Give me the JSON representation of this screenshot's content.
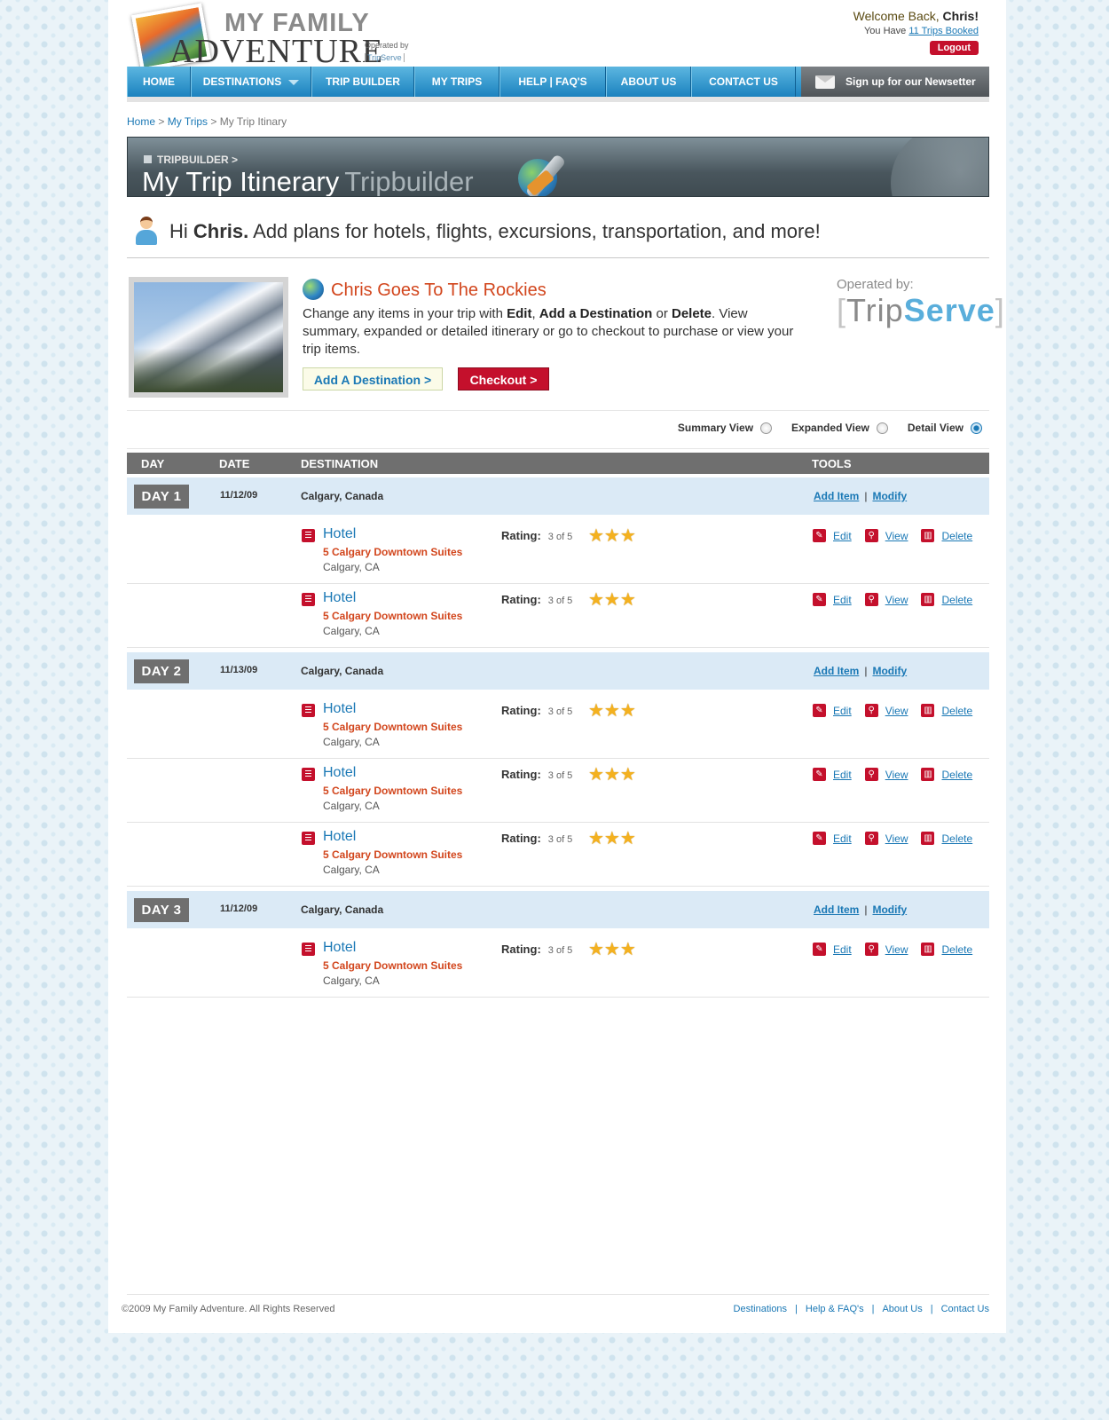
{
  "header": {
    "logo_line1": "MY FAMILY",
    "logo_line2": "ADVENTURE",
    "logo_operated": "Operated by",
    "logo_tripserve": "TripServe",
    "welcome_prefix": "Welcome Back, ",
    "welcome_name": "Chris!",
    "trips_prefix": "You Have ",
    "trips_link": "11 Trips Booked",
    "logout": "Logout"
  },
  "nav": {
    "items": [
      "HOME",
      "DESTINATIONS",
      "TRIP BUILDER",
      "MY TRIPS",
      "HELP | FAQ'S",
      "ABOUT US",
      "CONTACT US"
    ],
    "newsletter": "Sign up for our Newsetter"
  },
  "breadcrumb": {
    "home": "Home",
    "sep": " > ",
    "mytrips": "My Trips",
    "current": "My Trip Itinary"
  },
  "banner": {
    "sub": "TRIPBUILDER >",
    "title": "My Trip Itinerary",
    "title_accent": "Tripbuilder"
  },
  "greeting": {
    "hi": "Hi ",
    "name": "Chris.",
    "rest": " Add plans for hotels, flights, excursions, transportation, and more!"
  },
  "trip": {
    "title": "Chris Goes To The Rockies",
    "desc_1": "Change any items in your trip with ",
    "desc_edit": "Edit",
    "desc_2": ", ",
    "desc_add": "Add a Destination",
    "desc_3": " or ",
    "desc_delete": "Delete",
    "desc_4": ". View summary, expanded or detailed itinerary or go to checkout to purchase or view your trip items.",
    "add_destination": "Add A Destination >",
    "checkout": "Checkout >",
    "operated_label": "Operated by:",
    "operated_trip": "Trip",
    "operated_serve": "Serve"
  },
  "views": {
    "summary": "Summary View",
    "expanded": "Expanded View",
    "detail": "Detail View",
    "selected": "detail"
  },
  "table": {
    "headers": {
      "day": "DAY",
      "date": "DATE",
      "destination": "DESTINATION",
      "tools": "TOOLS"
    },
    "add_item": "Add Item",
    "modify": "Modify",
    "rating_label": "Rating:",
    "edit": "Edit",
    "view": "View",
    "delete": "Delete",
    "days": [
      {
        "label": "DAY 1",
        "date": "11/12/09",
        "destination": "Calgary, Canada",
        "items": [
          {
            "type": "Hotel",
            "name": "5 Calgary Downtown Suites",
            "location": "Calgary, CA",
            "rating_text": "3 of 5",
            "rating": 3
          },
          {
            "type": "Hotel",
            "name": "5 Calgary Downtown Suites",
            "location": "Calgary, CA",
            "rating_text": "3 of 5",
            "rating": 3
          }
        ]
      },
      {
        "label": "DAY 2",
        "date": "11/13/09",
        "destination": "Calgary, Canada",
        "items": [
          {
            "type": "Hotel",
            "name": "5 Calgary Downtown Suites",
            "location": "Calgary, CA",
            "rating_text": "3 of 5",
            "rating": 3
          },
          {
            "type": "Hotel",
            "name": "5 Calgary Downtown Suites",
            "location": "Calgary, CA",
            "rating_text": "3 of 5",
            "rating": 3
          },
          {
            "type": "Hotel",
            "name": "5 Calgary Downtown Suites",
            "location": "Calgary, CA",
            "rating_text": "3 of 5",
            "rating": 3
          }
        ]
      },
      {
        "label": "DAY 3",
        "date": "11/12/09",
        "destination": "Calgary, Canada",
        "items": [
          {
            "type": "Hotel",
            "name": "5 Calgary Downtown Suites",
            "location": "Calgary, CA",
            "rating_text": "3 of 5",
            "rating": 3
          }
        ]
      }
    ]
  },
  "footer": {
    "copyright": "©2009 My Family Adventure. All Rights Reserved",
    "links": [
      "Destinations",
      "Help & FAQ's",
      "About Us",
      "Contact Us"
    ],
    "sep": "|"
  },
  "colors": {
    "accent_blue": "#1a78b5",
    "accent_red": "#c4102c",
    "accent_orange": "#d2461d",
    "day_row_bg": "#dbeaf6",
    "star": "#f4b11f"
  },
  "icons": {
    "hotel": "hotel-icon",
    "edit": "pencil-icon",
    "view": "magnifier-icon",
    "delete": "trash-icon",
    "newsletter": "envelope-icon"
  }
}
